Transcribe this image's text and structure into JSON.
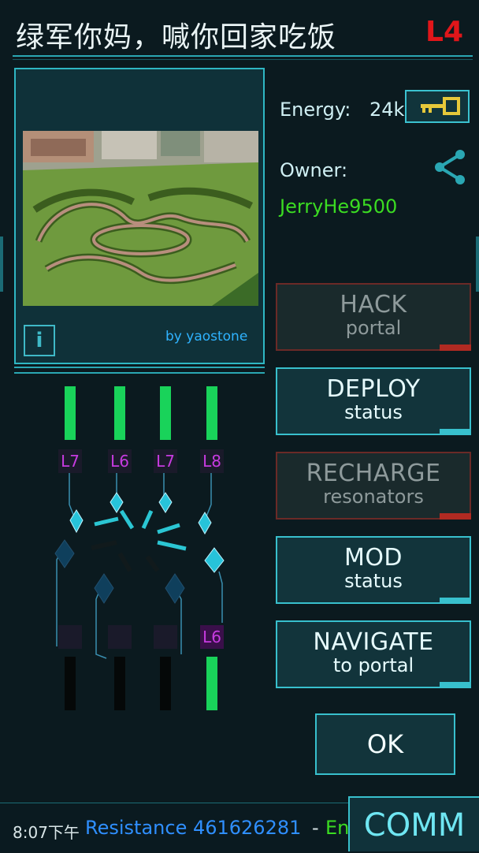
{
  "header": {
    "title": "绿军你妈，喊你回家吃饭",
    "level": "L4"
  },
  "portal": {
    "byline": "by yaostone",
    "info_label": "i"
  },
  "stats": {
    "energy_label": "Energy:",
    "energy_value": "24k",
    "owner_label": "Owner:",
    "owner_name": "JerryHe9500"
  },
  "actions": {
    "hack": {
      "line1": "HACK",
      "line2": "portal"
    },
    "deploy": {
      "line1": "DEPLOY",
      "line2": "status"
    },
    "recharge": {
      "line1": "RECHARGE",
      "line2": "resonators"
    },
    "mod": {
      "line1": "MOD",
      "line2": "status"
    },
    "navigate": {
      "line1": "NAVIGATE",
      "line2": "to portal"
    },
    "ok": "OK"
  },
  "resonators": {
    "top_levels": [
      "L7",
      "L6",
      "L7",
      "L8"
    ],
    "bottom_levels": [
      "",
      "",
      "",
      "L6"
    ]
  },
  "footer": {
    "time": "8:07下午",
    "team": "Resistance 461626281",
    "dash": "-",
    "faded": "Enlig",
    "comm": "COMM"
  },
  "colors": {
    "accent": "#38c0cd",
    "owner": "#3bdc22",
    "level": "#e0161a",
    "resistance": "#2f8fff"
  }
}
